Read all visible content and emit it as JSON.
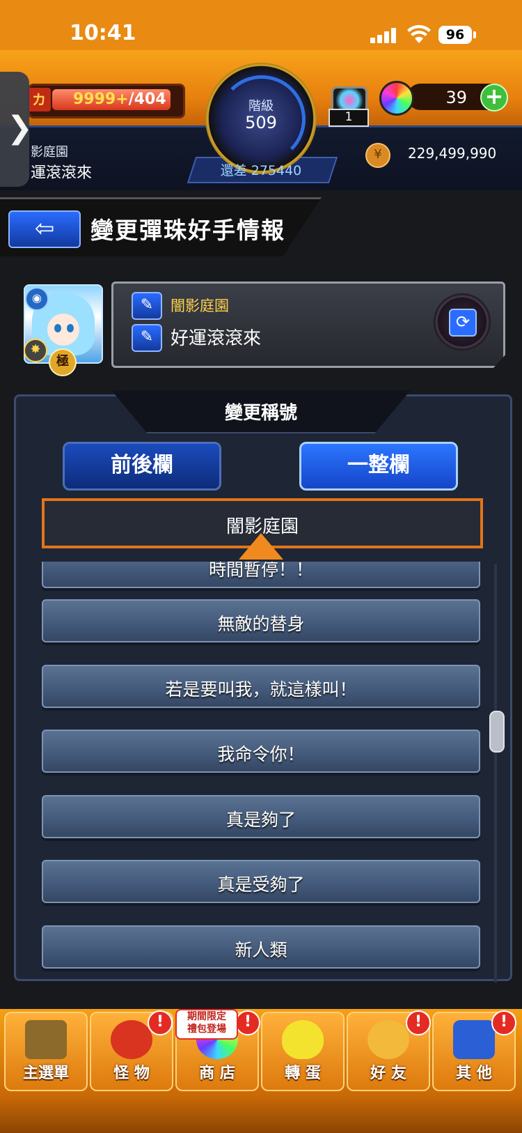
{
  "status_bar": {
    "time": "10:41",
    "battery": "96"
  },
  "header": {
    "stamina": "9999+",
    "stamina_max": "/404",
    "stamina_icon": "カ",
    "rank_label": "階級",
    "rank_value": "509",
    "rank_diff": "還差 275440",
    "user_title_partial": "影庭園",
    "user_name_partial": "運滾滾來",
    "chest_count": "1",
    "orb_count": "39",
    "coin_value": "229,499,990"
  },
  "title_bar": {
    "back_icon": "back-arrow-icon",
    "title": "變更彈珠好手情報"
  },
  "profile": {
    "title_text": "闇影庭園",
    "name_text": "好運滾滾來",
    "badge_label": "極"
  },
  "panel": {
    "heading": "變更稱號",
    "tabs": [
      {
        "label": "前後欄"
      },
      {
        "label": "一整欄"
      }
    ],
    "selected": "闇影庭園",
    "items": [
      "時間暫停！！",
      "無敵的替身",
      "若是要叫我，就這樣叫！",
      "我命令你！",
      "真是夠了",
      "真是受夠了",
      "新人類"
    ]
  },
  "nav": {
    "items": [
      {
        "label": "主選單",
        "alert": false
      },
      {
        "label": "怪 物",
        "alert": true
      },
      {
        "label": "商 店",
        "alert": true
      },
      {
        "label": "轉 蛋",
        "alert": false
      },
      {
        "label": "好 友",
        "alert": true
      },
      {
        "label": "其 他",
        "alert": true
      }
    ],
    "promo_line1": "期間限定",
    "promo_line2": "禮包登場",
    "alert_mark": "!"
  }
}
